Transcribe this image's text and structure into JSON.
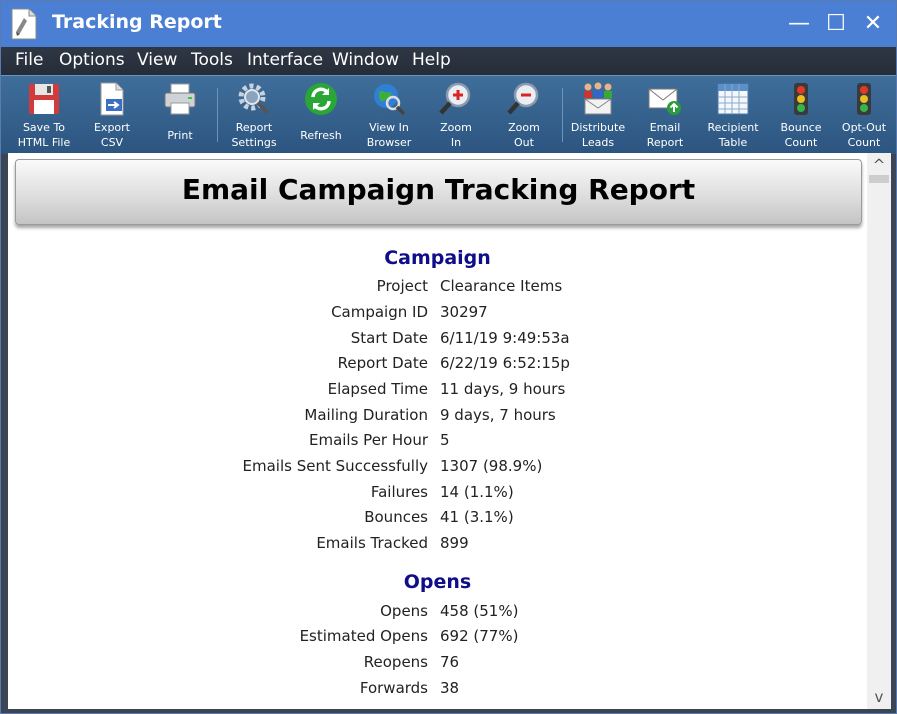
{
  "window": {
    "title": "Tracking Report",
    "controls": {
      "minimize": "—",
      "maximize": "☐",
      "close": "✕"
    }
  },
  "menu": [
    {
      "label": "File"
    },
    {
      "label": "Options"
    },
    {
      "label": "View"
    },
    {
      "label": "Tools"
    },
    {
      "label": "Interface"
    },
    {
      "label": "Window"
    },
    {
      "label": "Help"
    }
  ],
  "toolbar": [
    {
      "label": "Save To\nHTML File",
      "icon": "floppy-icon"
    },
    {
      "label": "Export\nCSV",
      "icon": "export-csv-icon"
    },
    {
      "label": "Print",
      "icon": "printer-icon"
    },
    {
      "label": "Report\nSettings",
      "icon": "gear-magnifier-icon"
    },
    {
      "label": "Refresh",
      "icon": "refresh-icon"
    },
    {
      "label": "View In\nBrowser",
      "icon": "globe-magnifier-icon"
    },
    {
      "label": "Zoom\nIn",
      "icon": "zoom-in-icon"
    },
    {
      "label": "Zoom\nOut",
      "icon": "zoom-out-icon"
    },
    {
      "label": "Distribute\nLeads",
      "icon": "people-envelope-icon"
    },
    {
      "label": "Email\nReport",
      "icon": "envelope-arrow-icon"
    },
    {
      "label": "Recipient\nTable",
      "icon": "table-icon"
    },
    {
      "label": "Bounce\nCount",
      "icon": "traffic-light-icon"
    },
    {
      "label": "Opt-Out\nCount",
      "icon": "traffic-light-icon"
    }
  ],
  "report": {
    "title": "Email Campaign Tracking Report",
    "campaign": {
      "heading": "Campaign",
      "rows": [
        {
          "key": "Project",
          "value": "Clearance Items"
        },
        {
          "key": "Campaign ID",
          "value": "30297"
        },
        {
          "key": "Start Date",
          "value": "6/11/19 9:49:53a"
        },
        {
          "key": "Report Date",
          "value": "6/22/19 6:52:15p"
        },
        {
          "key": "Elapsed Time",
          "value": "11 days, 9 hours"
        },
        {
          "key": "Mailing Duration",
          "value": "9 days, 7 hours"
        },
        {
          "key": "Emails Per Hour",
          "value": "5"
        },
        {
          "key": "Emails Sent Successfully",
          "value": "1307 (98.9%)"
        },
        {
          "key": "Failures",
          "value": "14 (1.1%)"
        },
        {
          "key": "Bounces",
          "value": "41 (3.1%)"
        },
        {
          "key": "Emails Tracked",
          "value": "899"
        }
      ]
    },
    "opens": {
      "heading": "Opens",
      "rows": [
        {
          "key": "Opens",
          "value": "458 (51%)"
        },
        {
          "key": "Estimated Opens",
          "value": "692 (77%)"
        },
        {
          "key": "Reopens",
          "value": "76"
        },
        {
          "key": "Forwards",
          "value": "38"
        }
      ]
    }
  },
  "scrollbar": {
    "up": "^",
    "down": "v"
  }
}
